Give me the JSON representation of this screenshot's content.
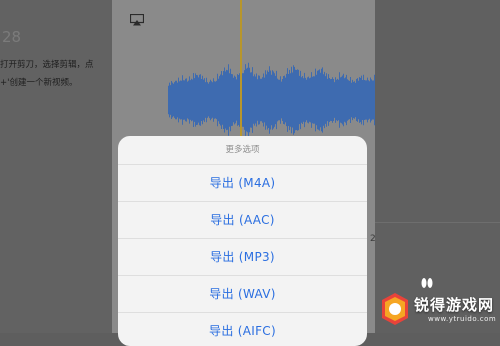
{
  "background_article": {
    "step_number": "28",
    "line1": "打开剪刀，选择剪辑，点",
    "line2": "+'创建一个新视频。"
  },
  "sheet": {
    "title": "更多选项",
    "items": [
      {
        "label": "导出 (M4A)"
      },
      {
        "label": "导出 (AAC)"
      },
      {
        "label": "导出 (MP3)"
      },
      {
        "label": "导出 (WAV)"
      },
      {
        "label": "导出 (AIFC)"
      }
    ]
  },
  "right_panel": {
    "mark": "2"
  },
  "watermark": {
    "site": "锐得游戏网",
    "url": "www.ytruido.com"
  },
  "colors": {
    "waveform": "#3e6bb0",
    "playhead": "#b8962b",
    "sheet_action": "#2a6ee0"
  },
  "waveform_profile": [
    0.45,
    0.5,
    0.6,
    0.55,
    0.7,
    0.65,
    0.5,
    0.55,
    0.75,
    0.9,
    0.6,
    0.8,
    0.95,
    0.7,
    0.6,
    0.85,
    0.75,
    0.55,
    0.8,
    0.9,
    0.7,
    0.6,
    0.75,
    0.85,
    0.65,
    0.55,
    0.7,
    0.6,
    0.5,
    0.65,
    0.55,
    0.6
  ]
}
